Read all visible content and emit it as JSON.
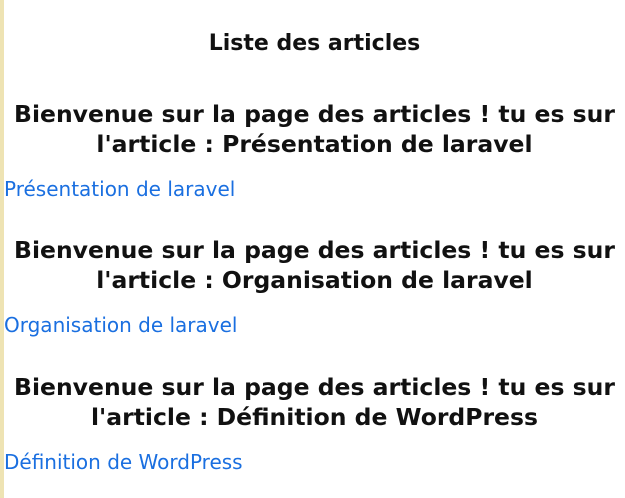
{
  "page": {
    "title": "Liste des articles",
    "accent_color": "#1a6fe0",
    "sidebar_color": "#eee3b3"
  },
  "articles": [
    {
      "heading": "Bienvenue sur la page des articles ! tu es sur l'article : Présentation de laravel",
      "link": "Présentation de laravel"
    },
    {
      "heading": "Bienvenue sur la page des articles ! tu es sur l'article : Organisation de laravel",
      "link": "Organisation de laravel"
    },
    {
      "heading": "Bienvenue sur la page des articles ! tu es sur l'article : Définition de WordPress",
      "link": "Définition de WordPress"
    }
  ]
}
